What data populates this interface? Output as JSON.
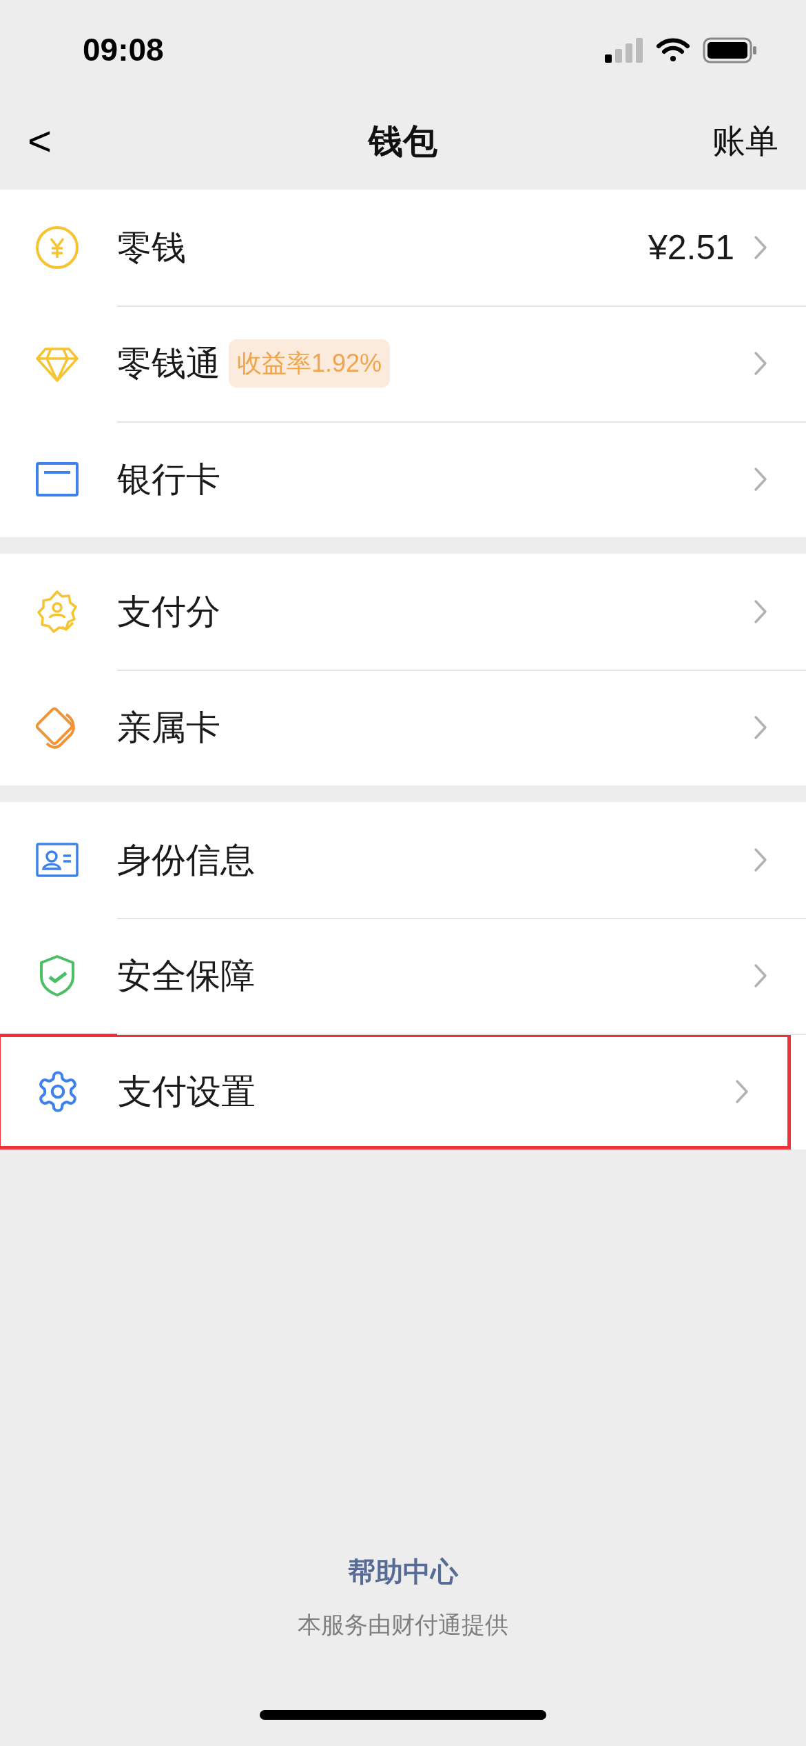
{
  "status_bar": {
    "time": "09:08"
  },
  "nav": {
    "back": "<",
    "title": "钱包",
    "action": "账单"
  },
  "groups": [
    {
      "items": [
        {
          "label": "零钱",
          "value": "¥2.51",
          "highlighted": false
        },
        {
          "label": "零钱通",
          "badge": "收益率1.92%",
          "highlighted": false
        },
        {
          "label": "银行卡",
          "highlighted": false
        }
      ]
    },
    {
      "items": [
        {
          "label": "支付分",
          "highlighted": false
        },
        {
          "label": "亲属卡",
          "highlighted": false
        }
      ]
    },
    {
      "items": [
        {
          "label": "身份信息",
          "highlighted": false
        },
        {
          "label": "安全保障",
          "highlighted": false
        },
        {
          "label": "支付设置",
          "highlighted": true
        }
      ]
    }
  ],
  "footer": {
    "link": "帮助中心",
    "note": "本服务由财付通提供"
  }
}
